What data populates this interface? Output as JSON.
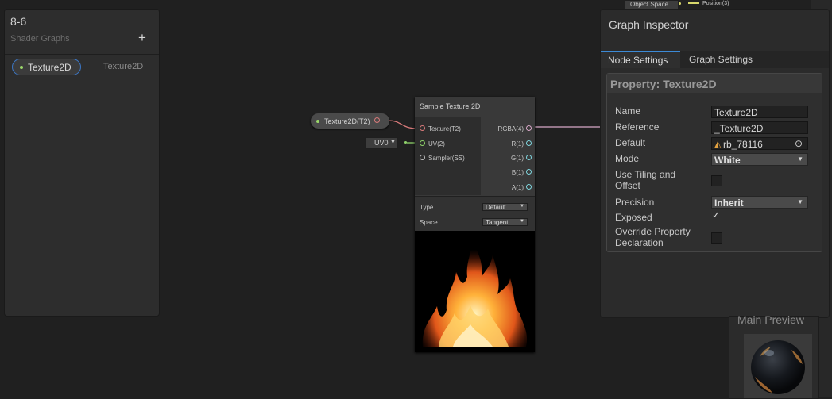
{
  "blackboard": {
    "title": "8-6",
    "subtitle": "Shader Graphs",
    "add_label": "+",
    "property": {
      "name": "Texture2D",
      "type": "Texture2D"
    }
  },
  "graph": {
    "property_node_label": "Texture2D(T2)",
    "uv_dropdown": "UV0",
    "top_node_fragment": {
      "label": "Object Space",
      "output": "Position(3)"
    },
    "sample_texture": {
      "title": "Sample Texture 2D",
      "inputs": [
        "Texture(T2)",
        "UV(2)",
        "Sampler(SS)"
      ],
      "outputs": [
        "RGBA(4)",
        "R(1)",
        "G(1)",
        "B(1)",
        "A(1)"
      ],
      "type_label": "Type",
      "type_value": "Default",
      "space_label": "Space",
      "space_value": "Tangent"
    }
  },
  "inspector": {
    "title": "Graph Inspector",
    "tabs": [
      "Node Settings",
      "Graph Settings"
    ],
    "active_tab": "Node Settings",
    "panel_title": "Property: Texture2D",
    "fields": {
      "name_label": "Name",
      "name_value": "Texture2D",
      "reference_label": "Reference",
      "reference_value": "_Texture2D",
      "default_label": "Default",
      "default_value": "rb_78116",
      "mode_label": "Mode",
      "mode_value": "White",
      "tiling_label_line1": "Use Tiling and",
      "tiling_label_line2": "Offset",
      "precision_label": "Precision",
      "precision_value": "Inherit",
      "exposed_label": "Exposed",
      "override_label_line1": "Override Property",
      "override_label_line2": "Declaration"
    },
    "checkbox_states": {
      "use_tiling": false,
      "exposed": true,
      "override": false
    }
  },
  "main_preview": {
    "title": "Main Preview"
  },
  "colors": {
    "accent_blue": "#3c8ad6",
    "texture_port": "#d97a7a",
    "vector2_port": "#8fd36b",
    "output_port": "#7fd4dc"
  }
}
